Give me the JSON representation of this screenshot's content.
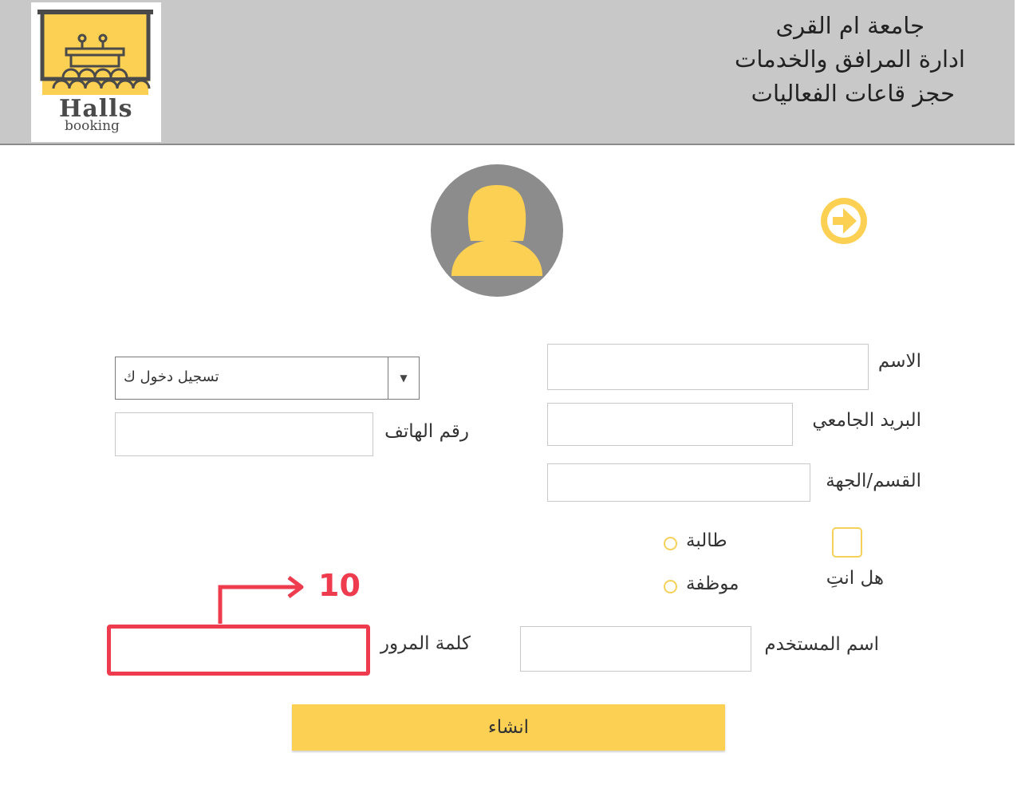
{
  "header": {
    "line1": "جامعة ام القرى",
    "line2": "ادارة المرافق والخدمات",
    "line3": "حجز قاعات الفعاليات",
    "logo_text_main": "Halls",
    "logo_text_sub": "booking"
  },
  "form": {
    "name_label": "الاسم",
    "email_label": "البريد الجامعي",
    "department_label": "القسم/الجهة",
    "phone_label": "رقم الهاتف",
    "login_type_value": "تسجيل دخول ك",
    "are_you_label": "هل انتِ",
    "option_student": "طالبة",
    "option_employee": "موظفة",
    "username_label": "اسم المستخدم",
    "password_label": "كلمة المرور",
    "submit_label": "انشاء"
  },
  "annotation": {
    "number": "10"
  },
  "colors": {
    "accent": "#fcd052",
    "header_bg": "#c8c8c8",
    "annotation": "#ee3b4e"
  },
  "icons": {
    "next": "arrow-right-circle-icon",
    "avatar": "user-avatar-icon",
    "logo": "lecture-hall-icon"
  }
}
